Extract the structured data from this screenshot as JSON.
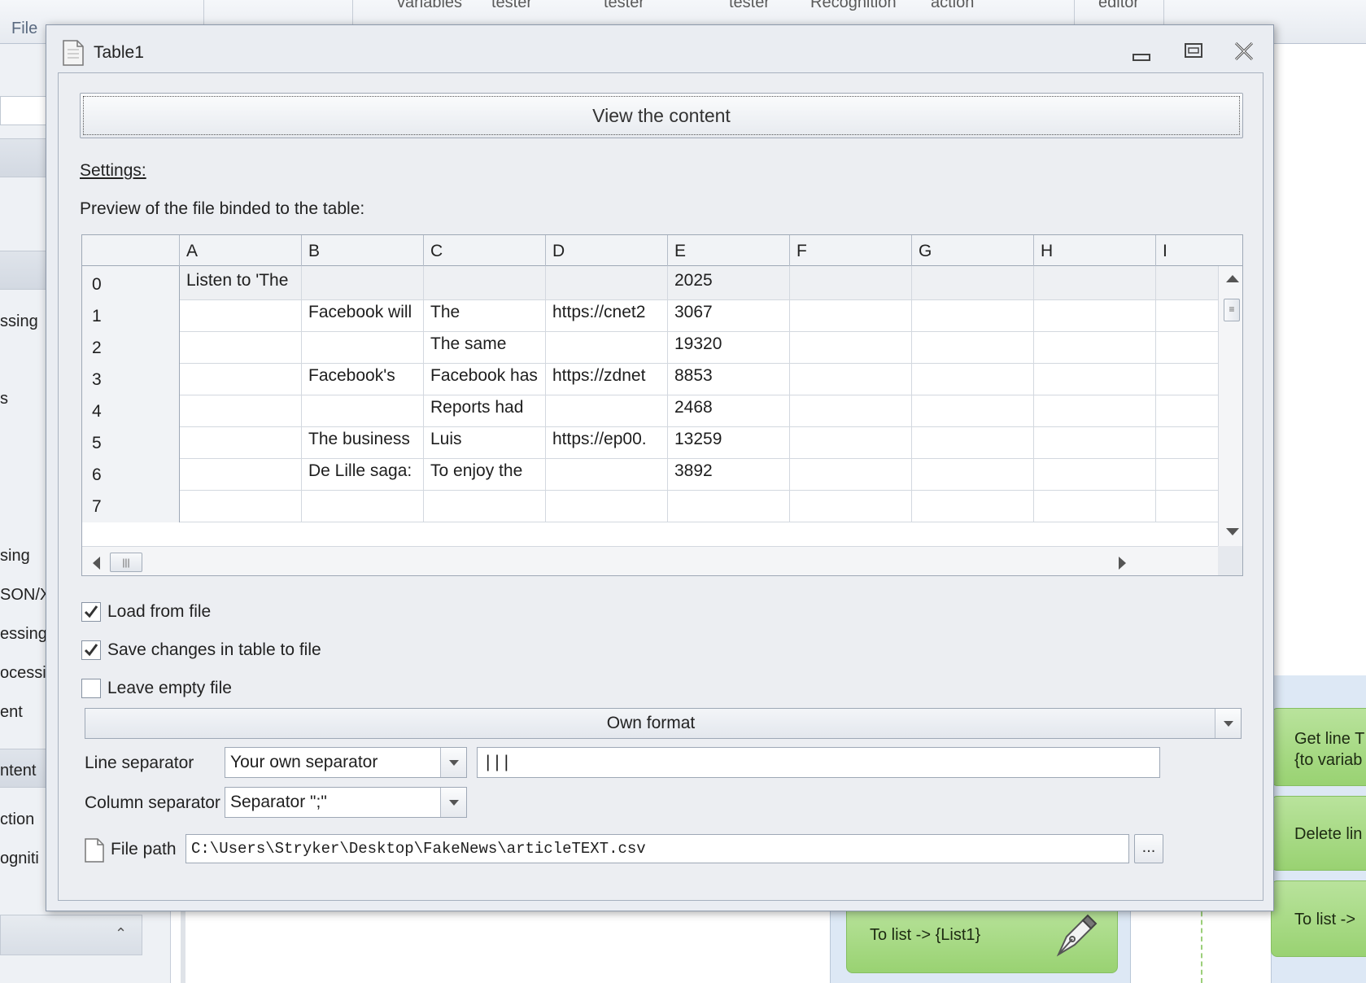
{
  "app": {
    "file_tab": "File",
    "ribbon_items": [
      "variables",
      "tester",
      "tester",
      "tester",
      "Recognition",
      "action",
      "editor"
    ],
    "left_labels": [
      "ssing",
      "s",
      "sing",
      "SON/X",
      "essing",
      "ocessin",
      "ent",
      "ntent",
      "ction",
      "ogniti"
    ],
    "green_blocks": {
      "to_list": "To list -> {List1}",
      "get_line_1": "Get line T",
      "get_line_2": "{to variab",
      "delete_line": "Delete lin",
      "to_list_right": "To list ->"
    }
  },
  "dialog": {
    "title": "Table1",
    "view_button": "View the content",
    "settings_link": "Settings:",
    "preview_label": "Preview of the file binded to the table:",
    "columns": [
      "A",
      "B",
      "C",
      "D",
      "E",
      "F",
      "G",
      "H",
      "I"
    ],
    "rows": [
      {
        "index": "0",
        "cells": [
          "Listen to 'The",
          "",
          "",
          "",
          "2025",
          "",
          "",
          "",
          ""
        ]
      },
      {
        "index": "1",
        "cells": [
          "",
          "Facebook will",
          "The",
          "https://cnet2",
          "3067",
          "",
          "",
          "",
          ""
        ]
      },
      {
        "index": "2",
        "cells": [
          "",
          "",
          "The same",
          "",
          "19320",
          "",
          "",
          "",
          ""
        ]
      },
      {
        "index": "3",
        "cells": [
          "",
          "Facebook's",
          "Facebook has",
          "https://zdnet",
          "8853",
          "",
          "",
          "",
          ""
        ]
      },
      {
        "index": "4",
        "cells": [
          "",
          "",
          "Reports had",
          "",
          "2468",
          "",
          "",
          "",
          ""
        ]
      },
      {
        "index": "5",
        "cells": [
          "",
          "The business",
          "Luis",
          "https://ep00.",
          "13259",
          "",
          "",
          "",
          ""
        ]
      },
      {
        "index": "6",
        "cells": [
          "",
          "De Lille saga:",
          "To enjoy the",
          "",
          "3892",
          "",
          "",
          "",
          ""
        ]
      },
      {
        "index": "7",
        "cells": [
          "",
          "",
          "",
          "",
          "",
          "",
          "",
          "",
          ""
        ]
      }
    ],
    "checkboxes": [
      {
        "label": "Load from file",
        "checked": true
      },
      {
        "label": "Save changes in table to file",
        "checked": true
      },
      {
        "label": "Leave empty file",
        "checked": false
      }
    ],
    "format": "Own format",
    "line_separator_label": "Line separator",
    "line_separator_value": "Your own separator",
    "line_separator_custom": "| | |",
    "column_separator_label": "Column separator",
    "column_separator_value": "Separator \";\"",
    "file_path_label": "File path",
    "file_path_value": "C:\\Users\\Stryker\\Desktop\\FakeNews\\articleTEXT.csv",
    "browse_label": "..."
  }
}
